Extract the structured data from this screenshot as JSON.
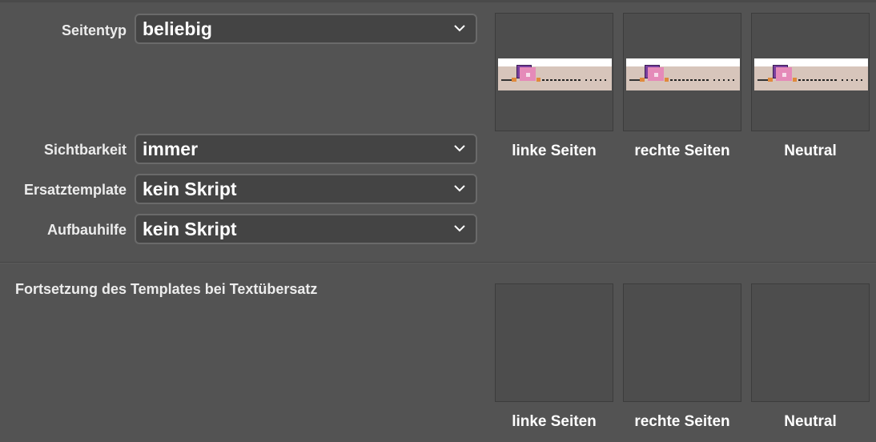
{
  "form": {
    "seitentyp": {
      "label": "Seitentyp",
      "value": "beliebig"
    },
    "sichtbarkeit": {
      "label": "Sichtbarkeit",
      "value": "immer"
    },
    "ersatztemplate": {
      "label": "Ersatztemplate",
      "value": "kein Skript"
    },
    "aufbauhilfe": {
      "label": "Aufbauhilfe",
      "value": "kein Skript"
    }
  },
  "previews": [
    {
      "label": "linke Seiten"
    },
    {
      "label": "rechte Seiten"
    },
    {
      "label": "Neutral"
    }
  ],
  "continuation": {
    "title": "Fortsetzung des Templates bei Textübersatz",
    "previews": [
      {
        "label": "linke Seiten"
      },
      {
        "label": "rechte Seiten"
      },
      {
        "label": "Neutral"
      }
    ]
  },
  "colors": {
    "background": "#535353",
    "field_background": "#444444",
    "field_border": "#6a6a6a",
    "thumb_background": "#4d4d4d",
    "preview_background": "#d7c5bb",
    "logo_purple": "#7a3f9e",
    "logo_pink": "#e58ab9",
    "accent_orange": "#e08a3c"
  },
  "icons": {
    "dropdown": "chevron-down-icon",
    "preview_logo": "template-logo-icon"
  }
}
